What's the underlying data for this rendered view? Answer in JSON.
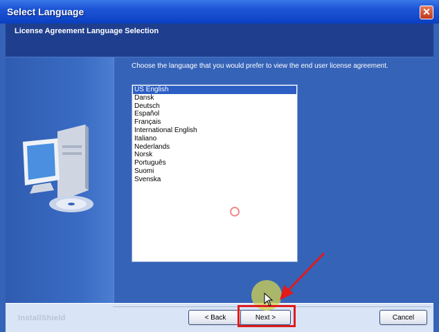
{
  "window": {
    "title": "Select Language",
    "close_glyph": "✕"
  },
  "header": {
    "heading": "License Agreement Language Selection"
  },
  "main": {
    "prompt": "Choose the language that you would prefer to view the end user license agreement.",
    "languages": [
      "US English",
      "Dansk",
      "Deutsch",
      "Español",
      "Français",
      "International English",
      "Italiano",
      "Nederlands",
      "Norsk",
      "Português",
      "Suomi",
      "Svenska"
    ],
    "selected_language": "US English"
  },
  "footer": {
    "brand": "InstallShield",
    "back_label": "< Back",
    "next_label": "Next >",
    "cancel_label": "Cancel"
  },
  "colors": {
    "title_bar": "#1f56d6",
    "background": "#3563b8",
    "selection": "#2c5ec4",
    "annotation": "#e01b1b"
  },
  "icons": [
    "close-icon",
    "computer-icon",
    "cd-icon",
    "busy-indicator-icon",
    "mouse-cursor-icon",
    "annotation-arrow-icon"
  ]
}
